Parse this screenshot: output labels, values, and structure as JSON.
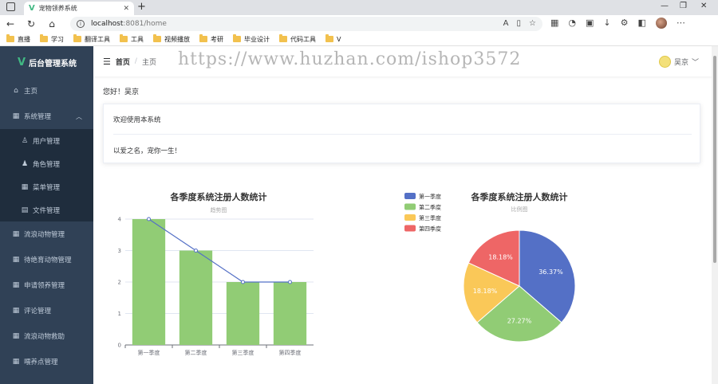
{
  "browser": {
    "tab_title": "宠物领养系统",
    "url_host": "localhost",
    "url_rest": ":8081/home",
    "bookmarks": [
      "直播",
      "学习",
      "翻译工具",
      "工具",
      "视频播放",
      "考研",
      "毕业设计",
      "代码工具",
      "V"
    ]
  },
  "sidebar": {
    "brand": "后台管理系统",
    "items": [
      {
        "label": "主页",
        "icon": "home-icon"
      },
      {
        "label": "系统管理",
        "icon": "grid-icon",
        "expanded": true
      },
      {
        "label": "用户管理",
        "icon": "user-icon",
        "sub": true
      },
      {
        "label": "角色管理",
        "icon": "person-icon",
        "sub": true
      },
      {
        "label": "菜单管理",
        "icon": "grid-icon",
        "sub": true
      },
      {
        "label": "文件管理",
        "icon": "document-icon",
        "sub": true
      },
      {
        "label": "流浪动物管理",
        "icon": "grid-icon"
      },
      {
        "label": "待绝育动物管理",
        "icon": "grid-icon"
      },
      {
        "label": "申请领养管理",
        "icon": "grid-icon"
      },
      {
        "label": "评论管理",
        "icon": "grid-icon"
      },
      {
        "label": "流浪动物救助",
        "icon": "grid-icon"
      },
      {
        "label": "喂养点管理",
        "icon": "grid-icon"
      }
    ]
  },
  "header": {
    "breadcrumb_home": "首页",
    "breadcrumb_sep": "/",
    "breadcrumb_current": "主页",
    "watermark": "https://www.huzhan.com/ishop3572",
    "user_name": "吴京"
  },
  "main": {
    "greeting": "您好！吴京",
    "card_header": "欢迎使用本系统",
    "card_body": "以爱之名，宠你一生！"
  },
  "chart_data": [
    {
      "type": "bar",
      "title": "各季度系统注册人数统计",
      "subtitle": "趋势图",
      "categories": [
        "第一季度",
        "第二季度",
        "第三季度",
        "第四季度"
      ],
      "series": [
        {
          "type": "bar",
          "values": [
            4,
            3,
            2,
            2
          ],
          "color": "#91cc75"
        },
        {
          "type": "line",
          "values": [
            4,
            3,
            2,
            2
          ],
          "color": "#5470c6"
        }
      ],
      "yticks": [
        0,
        1,
        2,
        3,
        4
      ],
      "ylim": [
        0,
        4
      ]
    },
    {
      "type": "pie",
      "title": "各季度系统注册人数统计",
      "subtitle": "比例图",
      "legend_position": "top-left",
      "slices": [
        {
          "name": "第一季度",
          "value": 36.37,
          "label": "36.37%",
          "color": "#5470c6"
        },
        {
          "name": "第二季度",
          "value": 27.27,
          "label": "27.27%",
          "color": "#91cc75"
        },
        {
          "name": "第三季度",
          "value": 18.18,
          "label": "18.18%",
          "color": "#fac858"
        },
        {
          "name": "第四季度",
          "value": 18.18,
          "label": "18.18%",
          "color": "#ee6666"
        }
      ]
    }
  ]
}
